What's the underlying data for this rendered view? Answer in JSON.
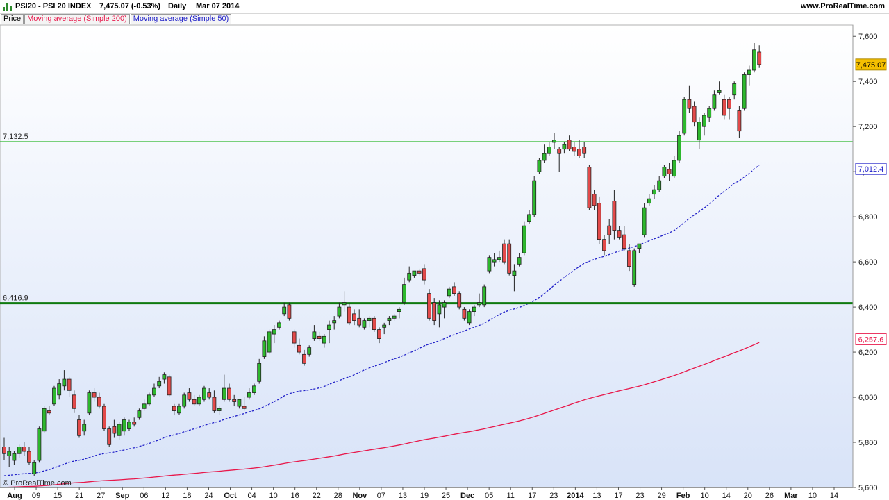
{
  "header": {
    "title": "PSI20 - PSI 20 INDEX",
    "last_change": "7,475.07 (-0.53%)",
    "period": "Daily",
    "date": "Mar 07 2014",
    "site": "www.ProRealTime.com"
  },
  "legend": {
    "price": "Price",
    "ma200": "Moving average (Simple 200)",
    "ma50": "Moving average (Simple 50)"
  },
  "copyright": "© ProRealTime.com",
  "colors": {
    "up": "#2db82d",
    "down": "#e34a4a",
    "ma200": "#e8174a",
    "ma50": "#2020c8",
    "hline": "#2db82d",
    "hline_strong": "#0e7a0e",
    "last_badge": "#f5c000"
  },
  "chart_data": {
    "type": "candlestick",
    "title": "PSI20 - PSI 20 INDEX",
    "ylim": [
      5600,
      7650
    ],
    "y_ticks": [
      "5,600",
      "5,800",
      "6,000",
      "6,200",
      "6,400",
      "6,600",
      "6,800",
      "7,000",
      "7,200",
      "7,400",
      "7,600"
    ],
    "x_ticks": [
      "Aug",
      "09",
      "15",
      "21",
      "27",
      "Sep",
      "06",
      "12",
      "18",
      "24",
      "Oct",
      "04",
      "10",
      "16",
      "22",
      "28",
      "Nov",
      "07",
      "13",
      "19",
      "25",
      "Dec",
      "05",
      "11",
      "17",
      "23",
      "2014",
      "13",
      "17",
      "23",
      "29",
      "Feb",
      "10",
      "14",
      "20",
      "26",
      "Mar",
      "10",
      "14"
    ],
    "horizontal_lines": [
      {
        "value": 7132.5,
        "label": "7,132.5"
      },
      {
        "value": 6416.9,
        "label": "6,416.9"
      }
    ],
    "last_price": {
      "value": 7475.07,
      "label": "7,475.07"
    },
    "ma_labels": [
      {
        "value": 7012.4,
        "label": "7,012.4",
        "series": "ma50"
      },
      {
        "value": 6257.6,
        "label": "6,257.6",
        "series": "ma200"
      }
    ],
    "candles": [
      {
        "o": 5780,
        "h": 5820,
        "l": 5720,
        "c": 5750
      },
      {
        "o": 5740,
        "h": 5780,
        "l": 5690,
        "c": 5760
      },
      {
        "o": 5720,
        "h": 5760,
        "l": 5700,
        "c": 5750
      },
      {
        "o": 5750,
        "h": 5790,
        "l": 5730,
        "c": 5780
      },
      {
        "o": 5780,
        "h": 5800,
        "l": 5740,
        "c": 5760
      },
      {
        "o": 5760,
        "h": 5780,
        "l": 5700,
        "c": 5710
      },
      {
        "o": 5660,
        "h": 5720,
        "l": 5650,
        "c": 5710
      },
      {
        "o": 5720,
        "h": 5870,
        "l": 5710,
        "c": 5860
      },
      {
        "o": 5850,
        "h": 5960,
        "l": 5840,
        "c": 5950
      },
      {
        "o": 5940,
        "h": 5960,
        "l": 5920,
        "c": 5930
      },
      {
        "o": 5970,
        "h": 6050,
        "l": 5960,
        "c": 6040
      },
      {
        "o": 6010,
        "h": 6080,
        "l": 5990,
        "c": 6060
      },
      {
        "o": 6050,
        "h": 6120,
        "l": 6030,
        "c": 6080
      },
      {
        "o": 6080,
        "h": 6090,
        "l": 6000,
        "c": 6030
      },
      {
        "o": 6010,
        "h": 6030,
        "l": 5930,
        "c": 5950
      },
      {
        "o": 5900,
        "h": 5920,
        "l": 5820,
        "c": 5830
      },
      {
        "o": 5850,
        "h": 5900,
        "l": 5830,
        "c": 5880
      },
      {
        "o": 5930,
        "h": 6030,
        "l": 5920,
        "c": 6020
      },
      {
        "o": 6020,
        "h": 6040,
        "l": 5980,
        "c": 6000
      },
      {
        "o": 6000,
        "h": 6020,
        "l": 5950,
        "c": 5960
      },
      {
        "o": 5960,
        "h": 5970,
        "l": 5850,
        "c": 5860
      },
      {
        "o": 5860,
        "h": 5870,
        "l": 5780,
        "c": 5790
      },
      {
        "o": 5870,
        "h": 5900,
        "l": 5820,
        "c": 5840
      },
      {
        "o": 5830,
        "h": 5890,
        "l": 5810,
        "c": 5880
      },
      {
        "o": 5850,
        "h": 5910,
        "l": 5830,
        "c": 5900
      },
      {
        "o": 5860,
        "h": 5900,
        "l": 5850,
        "c": 5890
      },
      {
        "o": 5890,
        "h": 5910,
        "l": 5870,
        "c": 5880
      },
      {
        "o": 5910,
        "h": 5950,
        "l": 5900,
        "c": 5940
      },
      {
        "o": 5950,
        "h": 5990,
        "l": 5940,
        "c": 5970
      },
      {
        "o": 5970,
        "h": 6020,
        "l": 5960,
        "c": 6010
      },
      {
        "o": 6010,
        "h": 6060,
        "l": 6000,
        "c": 6040
      },
      {
        "o": 6050,
        "h": 6090,
        "l": 6040,
        "c": 6070
      },
      {
        "o": 6080,
        "h": 6110,
        "l": 6060,
        "c": 6100
      },
      {
        "o": 6090,
        "h": 6100,
        "l": 6000,
        "c": 6010
      },
      {
        "o": 5960,
        "h": 5970,
        "l": 5920,
        "c": 5940
      },
      {
        "o": 5930,
        "h": 5970,
        "l": 5920,
        "c": 5960
      },
      {
        "o": 5960,
        "h": 6020,
        "l": 5950,
        "c": 6010
      },
      {
        "o": 6020,
        "h": 6040,
        "l": 5980,
        "c": 5990
      },
      {
        "o": 5990,
        "h": 6010,
        "l": 5960,
        "c": 5970
      },
      {
        "o": 5970,
        "h": 6010,
        "l": 5960,
        "c": 6000
      },
      {
        "o": 5990,
        "h": 6050,
        "l": 5980,
        "c": 6040
      },
      {
        "o": 6020,
        "h": 6040,
        "l": 5990,
        "c": 6000
      },
      {
        "o": 6000,
        "h": 6030,
        "l": 5930,
        "c": 5940
      },
      {
        "o": 5940,
        "h": 5960,
        "l": 5920,
        "c": 5950
      },
      {
        "o": 5990,
        "h": 6100,
        "l": 5980,
        "c": 6040
      },
      {
        "o": 6040,
        "h": 6060,
        "l": 5980,
        "c": 5990
      },
      {
        "o": 5990,
        "h": 6010,
        "l": 5960,
        "c": 5980
      },
      {
        "o": 5960,
        "h": 5990,
        "l": 5950,
        "c": 5990
      },
      {
        "o": 5960,
        "h": 6000,
        "l": 5940,
        "c": 5950
      },
      {
        "o": 6000,
        "h": 6040,
        "l": 5990,
        "c": 6020
      },
      {
        "o": 6020,
        "h": 6060,
        "l": 6010,
        "c": 6050
      },
      {
        "o": 6070,
        "h": 6170,
        "l": 6060,
        "c": 6150
      },
      {
        "o": 6180,
        "h": 6270,
        "l": 6170,
        "c": 6250
      },
      {
        "o": 6200,
        "h": 6300,
        "l": 6190,
        "c": 6290
      },
      {
        "o": 6280,
        "h": 6320,
        "l": 6240,
        "c": 6300
      },
      {
        "o": 6310,
        "h": 6340,
        "l": 6300,
        "c": 6330
      },
      {
        "o": 6370,
        "h": 6420,
        "l": 6360,
        "c": 6400
      },
      {
        "o": 6410,
        "h": 6420,
        "l": 6340,
        "c": 6350
      },
      {
        "o": 6290,
        "h": 6300,
        "l": 6220,
        "c": 6240
      },
      {
        "o": 6230,
        "h": 6260,
        "l": 6190,
        "c": 6200
      },
      {
        "o": 6190,
        "h": 6210,
        "l": 6140,
        "c": 6150
      },
      {
        "o": 6190,
        "h": 6230,
        "l": 6180,
        "c": 6220
      },
      {
        "o": 6260,
        "h": 6320,
        "l": 6250,
        "c": 6290
      },
      {
        "o": 6270,
        "h": 6290,
        "l": 6250,
        "c": 6260
      },
      {
        "o": 6240,
        "h": 6280,
        "l": 6220,
        "c": 6270
      },
      {
        "o": 6300,
        "h": 6340,
        "l": 6240,
        "c": 6320
      },
      {
        "o": 6330,
        "h": 6360,
        "l": 6300,
        "c": 6340
      },
      {
        "o": 6360,
        "h": 6420,
        "l": 6350,
        "c": 6400
      },
      {
        "o": 6410,
        "h": 6470,
        "l": 6380,
        "c": 6420
      },
      {
        "o": 6400,
        "h": 6420,
        "l": 6320,
        "c": 6330
      },
      {
        "o": 6370,
        "h": 6390,
        "l": 6320,
        "c": 6340
      },
      {
        "o": 6350,
        "h": 6390,
        "l": 6310,
        "c": 6320
      },
      {
        "o": 6310,
        "h": 6350,
        "l": 6300,
        "c": 6340
      },
      {
        "o": 6340,
        "h": 6360,
        "l": 6310,
        "c": 6350
      },
      {
        "o": 6350,
        "h": 6360,
        "l": 6290,
        "c": 6300
      },
      {
        "o": 6300,
        "h": 6310,
        "l": 6240,
        "c": 6260
      },
      {
        "o": 6310,
        "h": 6330,
        "l": 6280,
        "c": 6320
      },
      {
        "o": 6340,
        "h": 6360,
        "l": 6320,
        "c": 6350
      },
      {
        "o": 6350,
        "h": 6370,
        "l": 6340,
        "c": 6360
      },
      {
        "o": 6380,
        "h": 6400,
        "l": 6350,
        "c": 6390
      },
      {
        "o": 6420,
        "h": 6530,
        "l": 6410,
        "c": 6500
      },
      {
        "o": 6520,
        "h": 6580,
        "l": 6510,
        "c": 6550
      },
      {
        "o": 6540,
        "h": 6560,
        "l": 6530,
        "c": 6560
      },
      {
        "o": 6560,
        "h": 6570,
        "l": 6540,
        "c": 6550
      },
      {
        "o": 6570,
        "h": 6590,
        "l": 6500,
        "c": 6520
      },
      {
        "o": 6460,
        "h": 6480,
        "l": 6340,
        "c": 6350
      },
      {
        "o": 6420,
        "h": 6440,
        "l": 6320,
        "c": 6340
      },
      {
        "o": 6370,
        "h": 6430,
        "l": 6310,
        "c": 6410
      },
      {
        "o": 6400,
        "h": 6430,
        "l": 6350,
        "c": 6420
      },
      {
        "o": 6450,
        "h": 6490,
        "l": 6440,
        "c": 6480
      },
      {
        "o": 6490,
        "h": 6510,
        "l": 6450,
        "c": 6460
      },
      {
        "o": 6460,
        "h": 6470,
        "l": 6390,
        "c": 6400
      },
      {
        "o": 6390,
        "h": 6400,
        "l": 6340,
        "c": 6350
      },
      {
        "o": 6330,
        "h": 6390,
        "l": 6320,
        "c": 6380
      },
      {
        "o": 6380,
        "h": 6410,
        "l": 6360,
        "c": 6400
      },
      {
        "o": 6410,
        "h": 6460,
        "l": 6400,
        "c": 6420
      },
      {
        "o": 6410,
        "h": 6500,
        "l": 6400,
        "c": 6490
      },
      {
        "o": 6560,
        "h": 6630,
        "l": 6550,
        "c": 6620
      },
      {
        "o": 6600,
        "h": 6640,
        "l": 6580,
        "c": 6610
      },
      {
        "o": 6610,
        "h": 6650,
        "l": 6600,
        "c": 6620
      },
      {
        "o": 6680,
        "h": 6700,
        "l": 6590,
        "c": 6600
      },
      {
        "o": 6680,
        "h": 6700,
        "l": 6540,
        "c": 6550
      },
      {
        "o": 6540,
        "h": 6590,
        "l": 6470,
        "c": 6560
      },
      {
        "o": 6590,
        "h": 6640,
        "l": 6580,
        "c": 6620
      },
      {
        "o": 6640,
        "h": 6780,
        "l": 6630,
        "c": 6760
      },
      {
        "o": 6780,
        "h": 6830,
        "l": 6770,
        "c": 6810
      },
      {
        "o": 6810,
        "h": 6980,
        "l": 6800,
        "c": 6960
      },
      {
        "o": 7000,
        "h": 7060,
        "l": 6990,
        "c": 7050
      },
      {
        "o": 7050,
        "h": 7120,
        "l": 7040,
        "c": 7080
      },
      {
        "o": 7080,
        "h": 7130,
        "l": 7070,
        "c": 7110
      },
      {
        "o": 7130,
        "h": 7170,
        "l": 7100,
        "c": 7140
      },
      {
        "o": 7100,
        "h": 7110,
        "l": 7000,
        "c": 7080
      },
      {
        "o": 7100,
        "h": 7130,
        "l": 7080,
        "c": 7120
      },
      {
        "o": 7140,
        "h": 7160,
        "l": 7090,
        "c": 7100
      },
      {
        "o": 7110,
        "h": 7130,
        "l": 7070,
        "c": 7090
      },
      {
        "o": 7100,
        "h": 7140,
        "l": 7060,
        "c": 7070
      },
      {
        "o": 7110,
        "h": 7130,
        "l": 7060,
        "c": 7080
      },
      {
        "o": 7020,
        "h": 7030,
        "l": 6830,
        "c": 6840
      },
      {
        "o": 6900,
        "h": 6920,
        "l": 6830,
        "c": 6850
      },
      {
        "o": 6860,
        "h": 6890,
        "l": 6680,
        "c": 6700
      },
      {
        "o": 6700,
        "h": 6720,
        "l": 6630,
        "c": 6650
      },
      {
        "o": 6760,
        "h": 6790,
        "l": 6680,
        "c": 6720
      },
      {
        "o": 6870,
        "h": 6920,
        "l": 6700,
        "c": 6740
      },
      {
        "o": 6740,
        "h": 6760,
        "l": 6700,
        "c": 6710
      },
      {
        "o": 6720,
        "h": 6760,
        "l": 6650,
        "c": 6660
      },
      {
        "o": 6650,
        "h": 6680,
        "l": 6560,
        "c": 6580
      },
      {
        "o": 6500,
        "h": 6660,
        "l": 6490,
        "c": 6650
      },
      {
        "o": 6660,
        "h": 6680,
        "l": 6640,
        "c": 6680
      },
      {
        "o": 6720,
        "h": 6860,
        "l": 6710,
        "c": 6840
      },
      {
        "o": 6860,
        "h": 6900,
        "l": 6850,
        "c": 6880
      },
      {
        "o": 6900,
        "h": 6940,
        "l": 6880,
        "c": 6920
      },
      {
        "o": 6920,
        "h": 6980,
        "l": 6910,
        "c": 6960
      },
      {
        "o": 6980,
        "h": 7030,
        "l": 6970,
        "c": 7020
      },
      {
        "o": 7010,
        "h": 7040,
        "l": 6960,
        "c": 6990
      },
      {
        "o": 6980,
        "h": 7070,
        "l": 6970,
        "c": 7050
      },
      {
        "o": 7050,
        "h": 7180,
        "l": 7040,
        "c": 7160
      },
      {
        "o": 7170,
        "h": 7330,
        "l": 7160,
        "c": 7320
      },
      {
        "o": 7320,
        "h": 7380,
        "l": 7260,
        "c": 7280
      },
      {
        "o": 7290,
        "h": 7310,
        "l": 7200,
        "c": 7220
      },
      {
        "o": 7140,
        "h": 7240,
        "l": 7100,
        "c": 7220
      },
      {
        "o": 7200,
        "h": 7260,
        "l": 7160,
        "c": 7250
      },
      {
        "o": 7240,
        "h": 7290,
        "l": 7220,
        "c": 7280
      },
      {
        "o": 7280,
        "h": 7360,
        "l": 7270,
        "c": 7340
      },
      {
        "o": 7350,
        "h": 7400,
        "l": 7340,
        "c": 7360
      },
      {
        "o": 7320,
        "h": 7340,
        "l": 7230,
        "c": 7250
      },
      {
        "o": 7320,
        "h": 7330,
        "l": 7230,
        "c": 7280
      },
      {
        "o": 7340,
        "h": 7400,
        "l": 7320,
        "c": 7390
      },
      {
        "o": 7270,
        "h": 7290,
        "l": 7150,
        "c": 7180
      },
      {
        "o": 7280,
        "h": 7440,
        "l": 7270,
        "c": 7430
      },
      {
        "o": 7430,
        "h": 7470,
        "l": 7380,
        "c": 7450
      },
      {
        "o": 7450,
        "h": 7570,
        "l": 7440,
        "c": 7540
      },
      {
        "o": 7530,
        "h": 7560,
        "l": 7460,
        "c": 7475
      }
    ]
  }
}
